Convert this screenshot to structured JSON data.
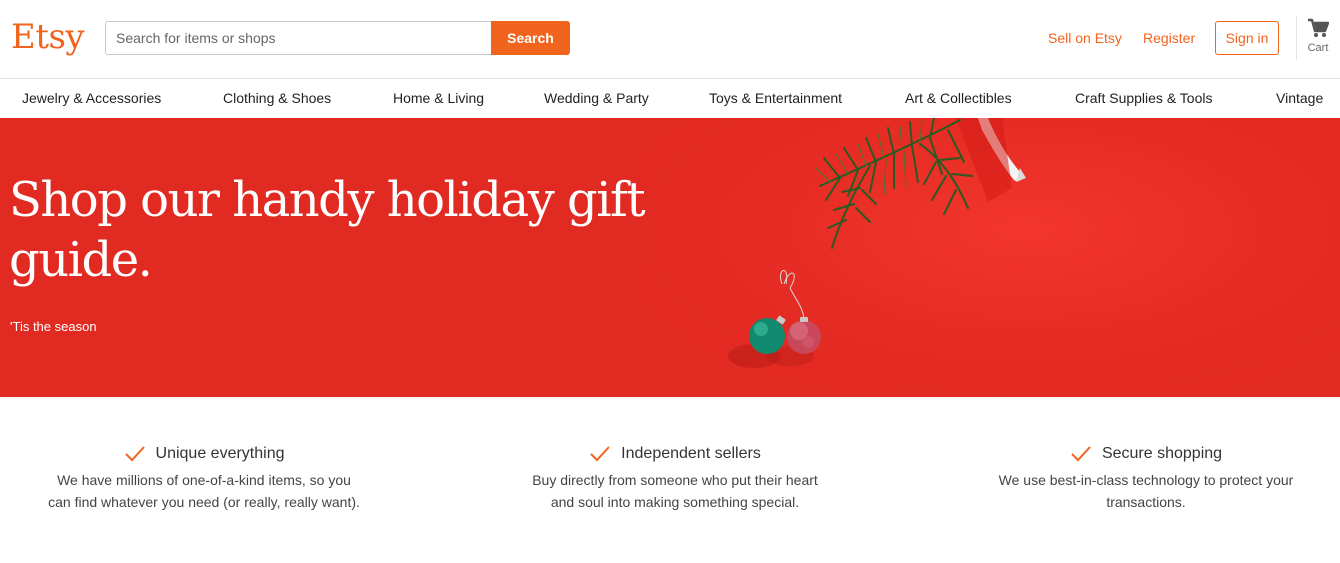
{
  "header": {
    "logo": "Etsy",
    "search_placeholder": "Search for items or shops",
    "search_button": "Search",
    "sell_link": "Sell on Etsy",
    "register_link": "Register",
    "signin_button": "Sign in",
    "cart_label": "Cart",
    "cart_icon": "cart-icon"
  },
  "categories": [
    "Jewelry & Accessories",
    "Clothing & Shoes",
    "Home & Living",
    "Wedding & Party",
    "Toys & Entertainment",
    "Art & Collectibles",
    "Craft Supplies & Tools",
    "Vintage"
  ],
  "hero": {
    "title": "Shop our handy holiday gift guide.",
    "subtitle": "'Tis the season",
    "background_color": "#e12a22"
  },
  "value_props": [
    {
      "icon": "check-icon",
      "title": "Unique everything",
      "desc_line1": "We have millions of one-of-a-kind items, so you",
      "desc_line2": "can find whatever you need (or really, really want)."
    },
    {
      "icon": "check-icon",
      "title": "Independent sellers",
      "desc_line1": "Buy directly from someone who put their heart",
      "desc_line2": "and soul into making something special."
    },
    {
      "icon": "check-icon",
      "title": "Secure shopping",
      "desc_line1": "We use best-in-class technology to protect your",
      "desc_line2": "transactions."
    }
  ],
  "colors": {
    "accent": "#f1641e",
    "hero_red": "#e12a22"
  }
}
